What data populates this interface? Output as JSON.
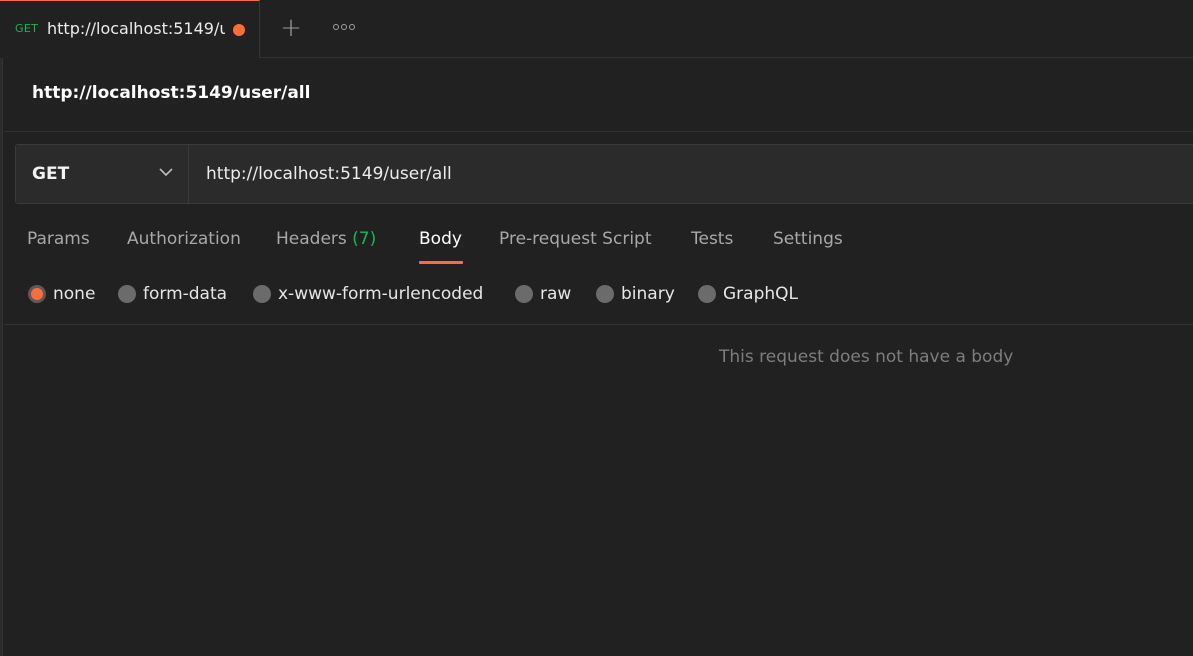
{
  "tab": {
    "method": "GET",
    "title": "http://localhost:5149/u",
    "unsaved_indicator_color": "#ff6c37"
  },
  "tab_actions": {
    "new_tab_icon": "plus-icon",
    "more_icon": "more-horizontal-icon"
  },
  "request": {
    "name": "http://localhost:5149/user/all",
    "method": "GET",
    "url": "http://localhost:5149/user/all"
  },
  "subtabs": [
    {
      "label": "Params"
    },
    {
      "label": "Authorization"
    },
    {
      "label": "Headers",
      "count": "(7)"
    },
    {
      "label": "Body",
      "active": true
    },
    {
      "label": "Pre-request Script"
    },
    {
      "label": "Tests"
    },
    {
      "label": "Settings"
    }
  ],
  "body_types": [
    {
      "label": "none",
      "checked": true
    },
    {
      "label": "form-data"
    },
    {
      "label": "x-www-form-urlencoded"
    },
    {
      "label": "raw"
    },
    {
      "label": "binary"
    },
    {
      "label": "GraphQL"
    }
  ],
  "body": {
    "empty_message": "This request does not have a body"
  },
  "colors": {
    "accent": "#ff6c37",
    "method_get": "#0cbb52",
    "background": "#212121"
  }
}
